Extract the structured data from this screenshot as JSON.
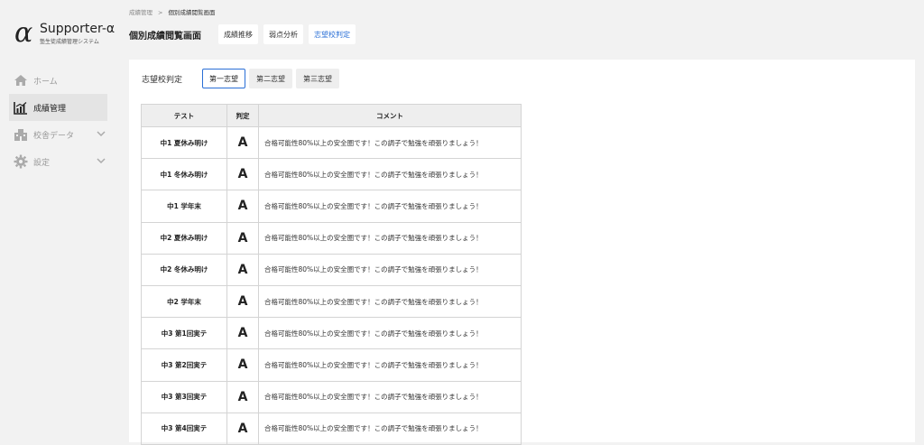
{
  "app": {
    "name": "Supporter-α",
    "subtitle": "塾生徒成績管理システム",
    "logo_glyph": "α"
  },
  "sidebar": {
    "items": [
      {
        "label": "ホーム",
        "icon": "home-icon",
        "active": false
      },
      {
        "label": "成績管理",
        "icon": "chart-icon",
        "active": true
      },
      {
        "label": "校舎データ",
        "icon": "building-icon",
        "active": false,
        "expandable": true
      },
      {
        "label": "設定",
        "icon": "gear-icon",
        "active": false,
        "expandable": true
      }
    ]
  },
  "breadcrumb": {
    "parent": "成績管理",
    "separator": ">",
    "current": "個別成績閲覧画面"
  },
  "header": {
    "title": "個別成績閲覧画面",
    "tabs": [
      {
        "label": "成績推移",
        "active": false
      },
      {
        "label": "弱点分析",
        "active": false
      },
      {
        "label": "志望校判定",
        "active": true
      }
    ]
  },
  "choice": {
    "label": "志望校判定",
    "options": [
      {
        "label": "第一志望",
        "active": true
      },
      {
        "label": "第二志望",
        "active": false
      },
      {
        "label": "第三志望",
        "active": false
      }
    ]
  },
  "table": {
    "headers": {
      "test": "テスト",
      "grade": "判定",
      "comment": "コメント"
    },
    "rows": [
      {
        "test": "中1 夏休み明け",
        "grade": "A",
        "comment": "合格可能性80%以上の安全圏です！この調子で勉強を頑張りましょう！"
      },
      {
        "test": "中1 冬休み明け",
        "grade": "A",
        "comment": "合格可能性80%以上の安全圏です！この調子で勉強を頑張りましょう！"
      },
      {
        "test": "中1 学年末",
        "grade": "A",
        "comment": "合格可能性80%以上の安全圏です！この調子で勉強を頑張りましょう！"
      },
      {
        "test": "中2 夏休み明け",
        "grade": "A",
        "comment": "合格可能性80%以上の安全圏です！この調子で勉強を頑張りましょう！"
      },
      {
        "test": "中2 冬休み明け",
        "grade": "A",
        "comment": "合格可能性80%以上の安全圏です！この調子で勉強を頑張りましょう！"
      },
      {
        "test": "中2 学年末",
        "grade": "A",
        "comment": "合格可能性80%以上の安全圏です！この調子で勉強を頑張りましょう！"
      },
      {
        "test": "中3 第1回実テ",
        "grade": "A",
        "comment": "合格可能性80%以上の安全圏です！この調子で勉強を頑張りましょう！"
      },
      {
        "test": "中3 第2回実テ",
        "grade": "A",
        "comment": "合格可能性80%以上の安全圏です！この調子で勉強を頑張りましょう！"
      },
      {
        "test": "中3 第3回実テ",
        "grade": "A",
        "comment": "合格可能性80%以上の安全圏です！この調子で勉強を頑張りましょう！"
      },
      {
        "test": "中3 第4回実テ",
        "grade": "A",
        "comment": "合格可能性80%以上の安全圏です！この調子で勉強を頑張りましょう！"
      }
    ]
  },
  "colors": {
    "accent": "#2a6fd6",
    "background": "#f2f2f2",
    "header_bg": "#eeeeee"
  }
}
